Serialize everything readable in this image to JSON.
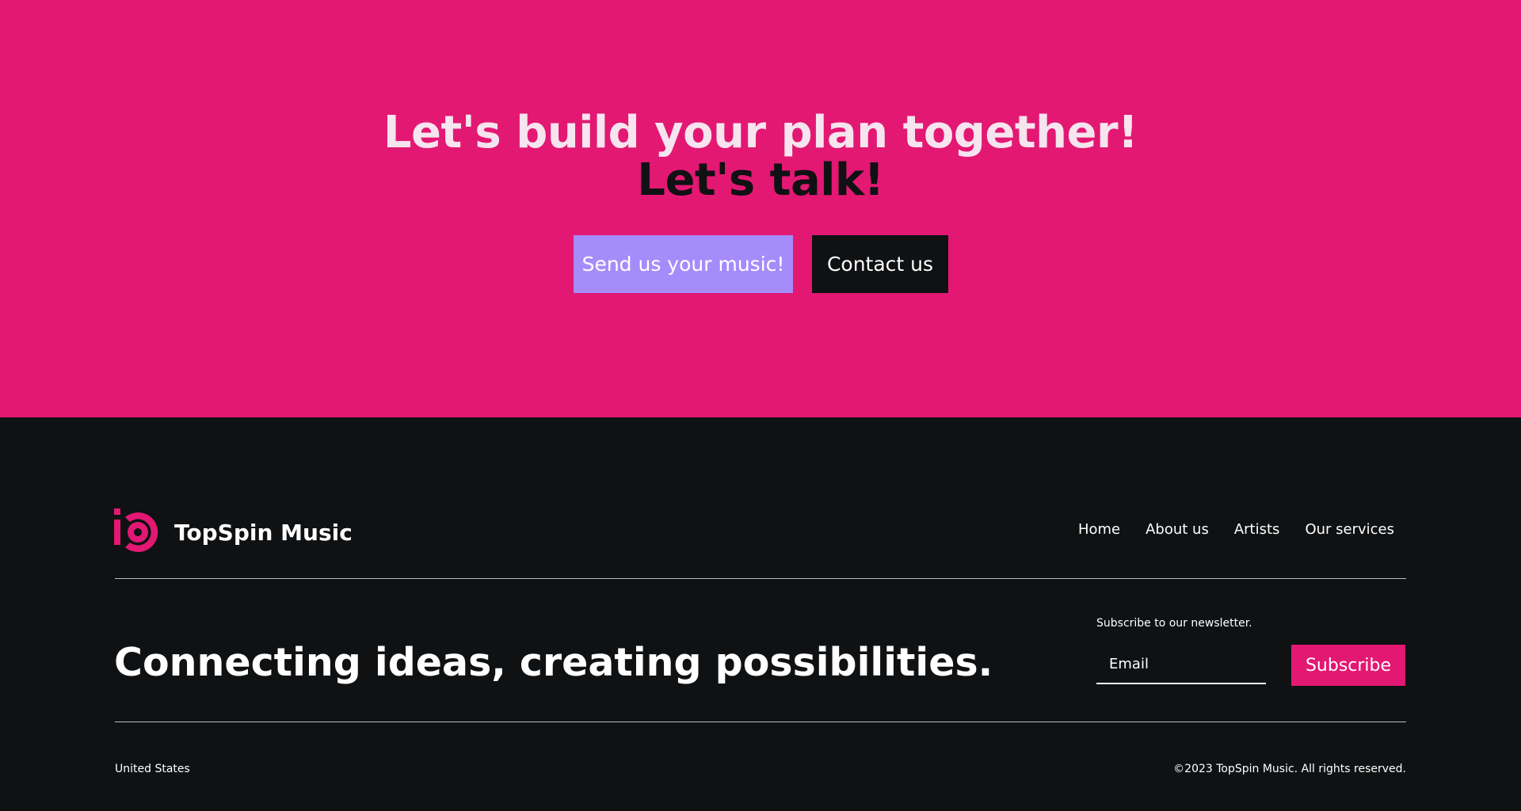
{
  "colors": {
    "brand_pink": "#e31873",
    "accent_purple": "#a68cfb",
    "dark": "#0f1113",
    "heading_light": "#f6e4ee"
  },
  "cta": {
    "title_line1": "Let's build your plan together!",
    "title_line2": "Let's talk!",
    "send_music_label": "Send us your music!",
    "contact_label": "Contact us"
  },
  "footer": {
    "logo_icon": "topspin-logo-icon",
    "brand_name": "TopSpin Music",
    "nav": [
      "Home",
      "About us",
      "Artists",
      "Our services"
    ],
    "tagline": "Connecting ideas, creating possibilities.",
    "newsletter": {
      "label": "Subscribe to our newsletter.",
      "email_placeholder": "Email",
      "subscribe_label": "Subscribe"
    },
    "country": "United States",
    "copyright": "©2023 TopSpin Music. All rights reserved."
  }
}
